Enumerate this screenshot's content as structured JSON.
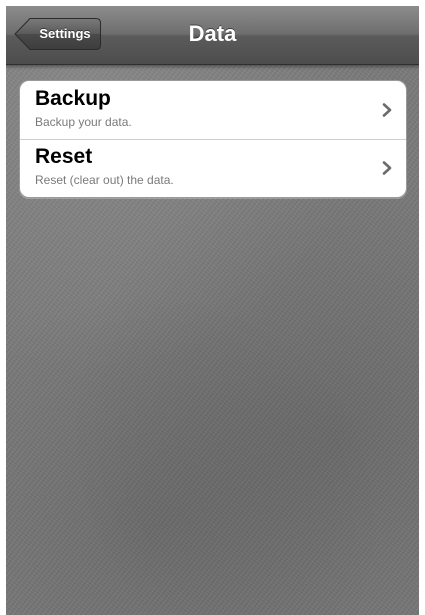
{
  "nav_bar": {
    "back_label": "Settings",
    "title": "Data"
  },
  "list": {
    "items": [
      {
        "title": "Backup",
        "subtitle": "Backup your data.",
        "icon": "chevron-right-icon"
      },
      {
        "title": "Reset",
        "subtitle": "Reset (clear out) the data.",
        "icon": "chevron-right-icon"
      }
    ]
  },
  "colors": {
    "nav_bar": "#5b5b5b",
    "background": "#7c7c7c",
    "row_background": "#ffffff",
    "subtitle_text": "#7a7a7a"
  }
}
